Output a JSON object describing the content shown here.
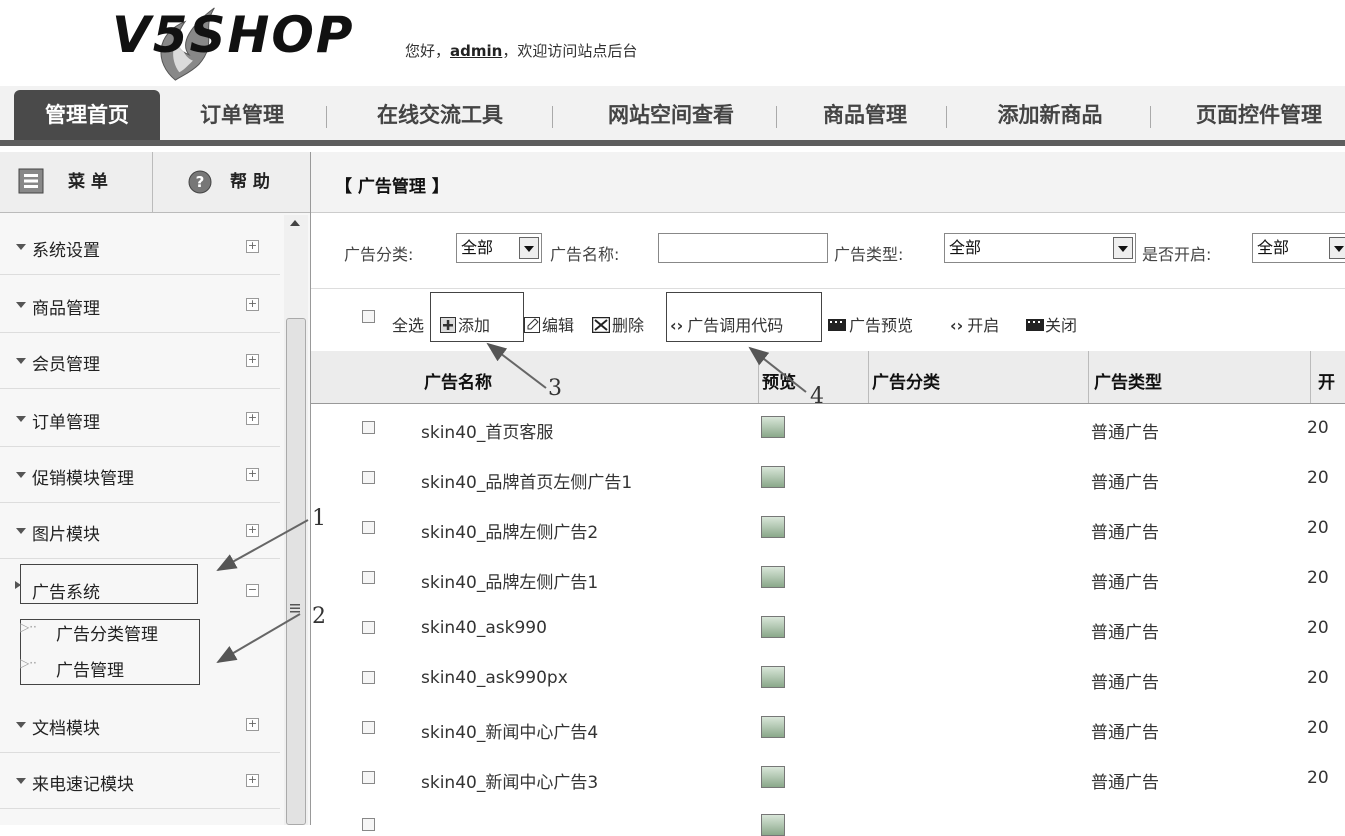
{
  "header": {
    "logo_text": "V5SHOP",
    "greeting_prefix": "您好，",
    "user": "admin",
    "greeting_suffix": "，欢迎访问站点后台"
  },
  "nav": {
    "tabs": [
      "管理首页",
      "订单管理",
      "在线交流工具",
      "网站空间查看",
      "商品管理",
      "添加新商品",
      "页面控件管理"
    ]
  },
  "sidebar": {
    "menu_tab": "菜 单",
    "help_tab": "帮 助",
    "items": [
      {
        "label": "系统设置",
        "toggle": "+"
      },
      {
        "label": "商品管理",
        "toggle": "+"
      },
      {
        "label": "会员管理",
        "toggle": "+"
      },
      {
        "label": "订单管理",
        "toggle": "+"
      },
      {
        "label": "促销模块管理",
        "toggle": "+"
      },
      {
        "label": "图片模块",
        "toggle": "+"
      },
      {
        "label": "广告系统",
        "toggle": "−"
      },
      {
        "label": "文档模块",
        "toggle": "+"
      },
      {
        "label": "来电速记模块",
        "toggle": "+"
      }
    ],
    "subitems": [
      "广告分类管理",
      "广告管理"
    ]
  },
  "main": {
    "title": "【 广告管理 】",
    "filters": {
      "category_label": "广告分类:",
      "category_value": "全部",
      "name_label": "广告名称:",
      "name_value": "",
      "type_label": "广告类型:",
      "type_value": "全部",
      "enabled_label": "是否开启:",
      "enabled_value": "全部"
    },
    "toolbar": {
      "select_all": "全选",
      "add": "添加",
      "edit": "编辑",
      "delete": "删除",
      "code": "广告调用代码",
      "preview": "广告预览",
      "enable": "开启",
      "disable": "关闭"
    },
    "table": {
      "headers": [
        "广告名称",
        "预览",
        "广告分类",
        "广告类型",
        "开"
      ],
      "rows": [
        {
          "name": "skin40_首页客服",
          "type": "普通广告",
          "date": "20"
        },
        {
          "name": "skin40_品牌首页左侧广告1",
          "type": "普通广告",
          "date": "20"
        },
        {
          "name": "skin40_品牌左侧广告2",
          "type": "普通广告",
          "date": "20"
        },
        {
          "name": "skin40_品牌左侧广告1",
          "type": "普通广告",
          "date": "20"
        },
        {
          "name": "skin40_ask990",
          "type": "普通广告",
          "date": "20"
        },
        {
          "name": "skin40_ask990px",
          "type": "普通广告",
          "date": "20"
        },
        {
          "name": "skin40_新闻中心广告4",
          "type": "普通广告",
          "date": "20"
        },
        {
          "name": "skin40_新闻中心广告3",
          "type": "普通广告",
          "date": "20"
        }
      ]
    }
  },
  "annotations": [
    "1",
    "2",
    "3",
    "4"
  ]
}
